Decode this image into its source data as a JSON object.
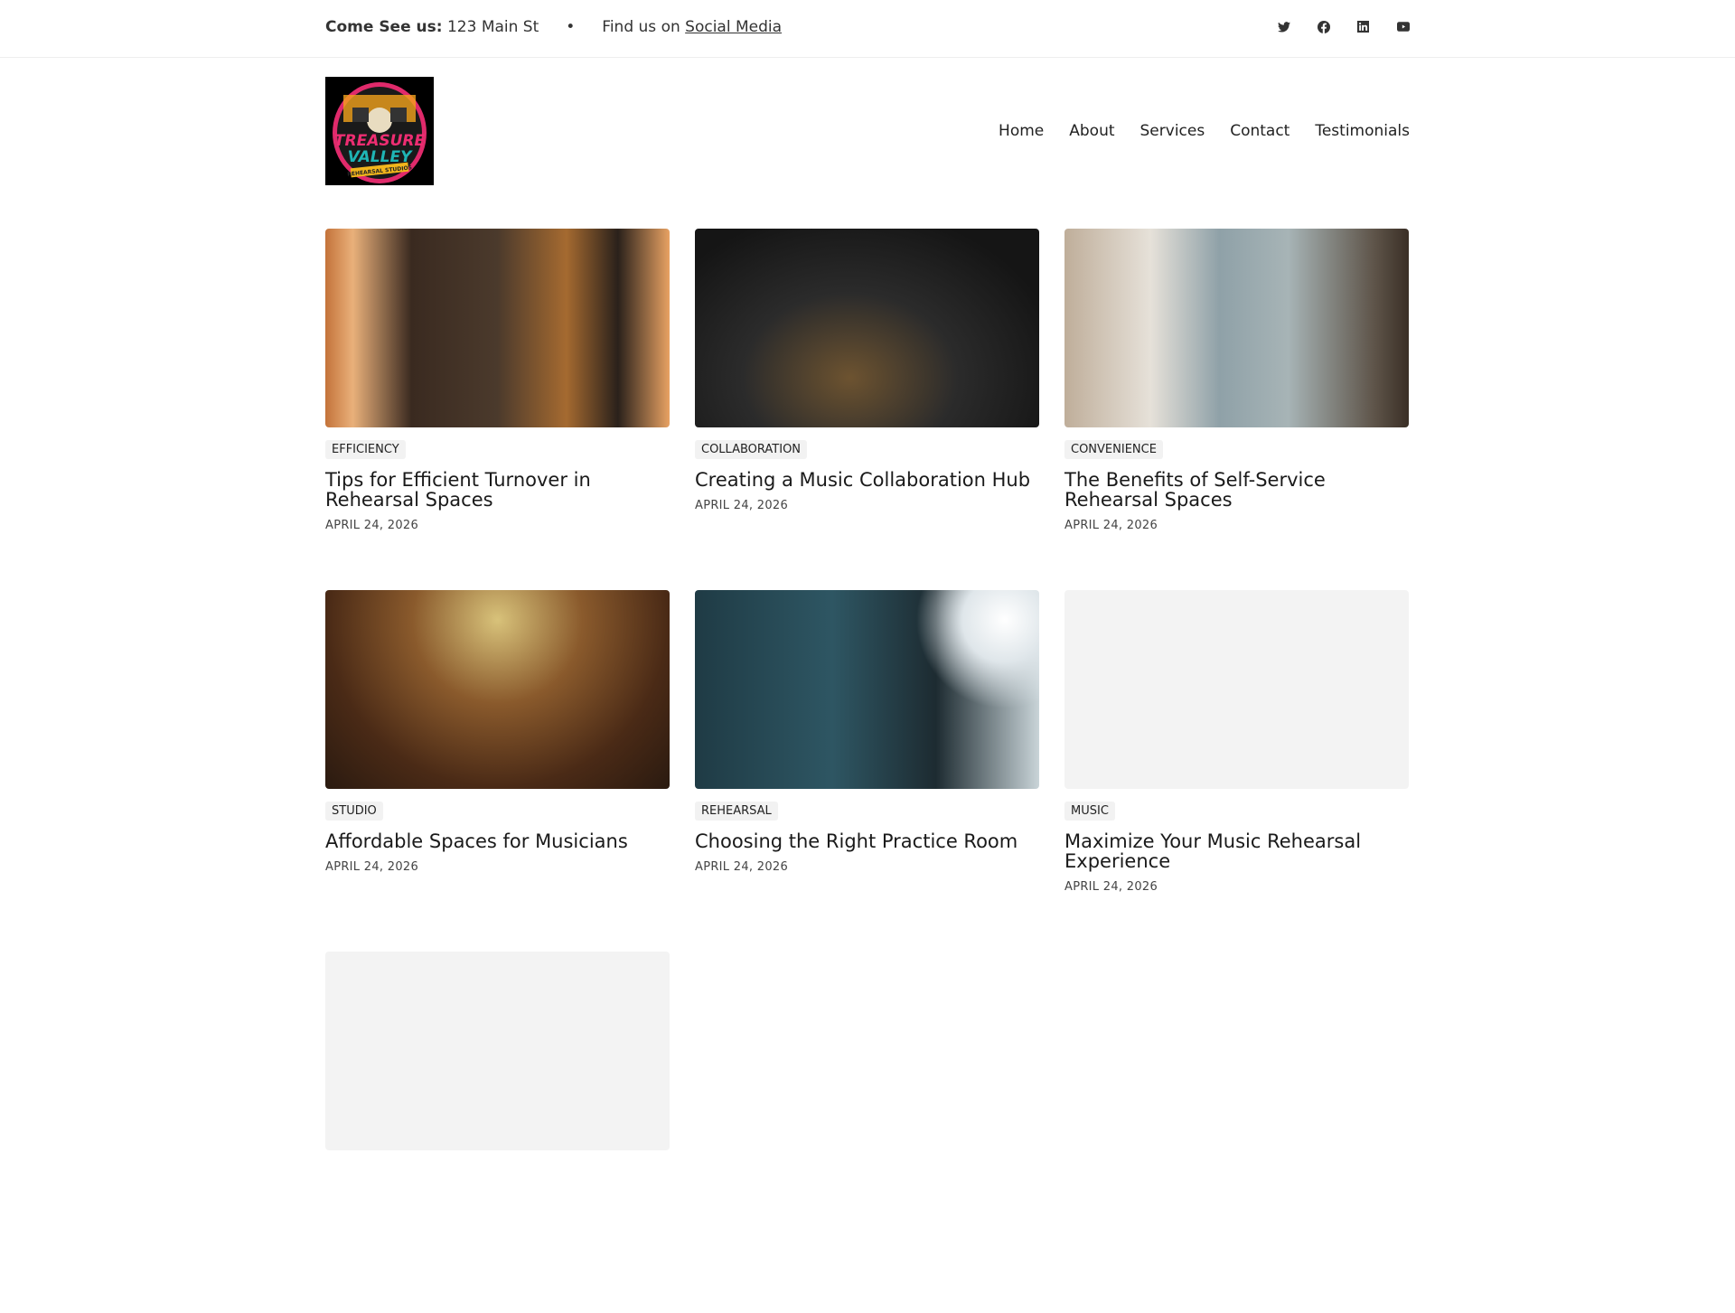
{
  "topbar": {
    "visit_label": "Come See us:",
    "address": "123 Main St",
    "separator": "•",
    "find_text": "Find us on",
    "social_link": "Social Media",
    "icons": [
      "twitter-icon",
      "facebook-icon",
      "linkedin-icon",
      "youtube-icon"
    ]
  },
  "logo": {
    "text": "Treasure Valley Rehearsal Studios"
  },
  "nav": [
    "Home",
    "About",
    "Services",
    "Contact",
    "Testimonials"
  ],
  "posts": [
    {
      "tag": "EFFICIENCY",
      "title": "Tips for Efficient Turnover in Rehearsal Spaces",
      "date": "APRIL 24, 2026"
    },
    {
      "tag": "COLLABORATION",
      "title": "Creating a Music Collaboration Hub",
      "date": "APRIL 24, 2026"
    },
    {
      "tag": "CONVENIENCE",
      "title": "The Benefits of Self-Service Rehearsal Spaces",
      "date": "APRIL 24, 2026"
    },
    {
      "tag": "STUDIO",
      "title": "Affordable Spaces for Musicians",
      "date": "APRIL 24, 2026"
    },
    {
      "tag": "REHEARSAL",
      "title": "Choosing the Right Practice Room",
      "date": "APRIL 24, 2026"
    },
    {
      "tag": "MUSIC",
      "title": "Maximize Your Music Rehearsal Experience",
      "date": "APRIL 24, 2026"
    }
  ]
}
